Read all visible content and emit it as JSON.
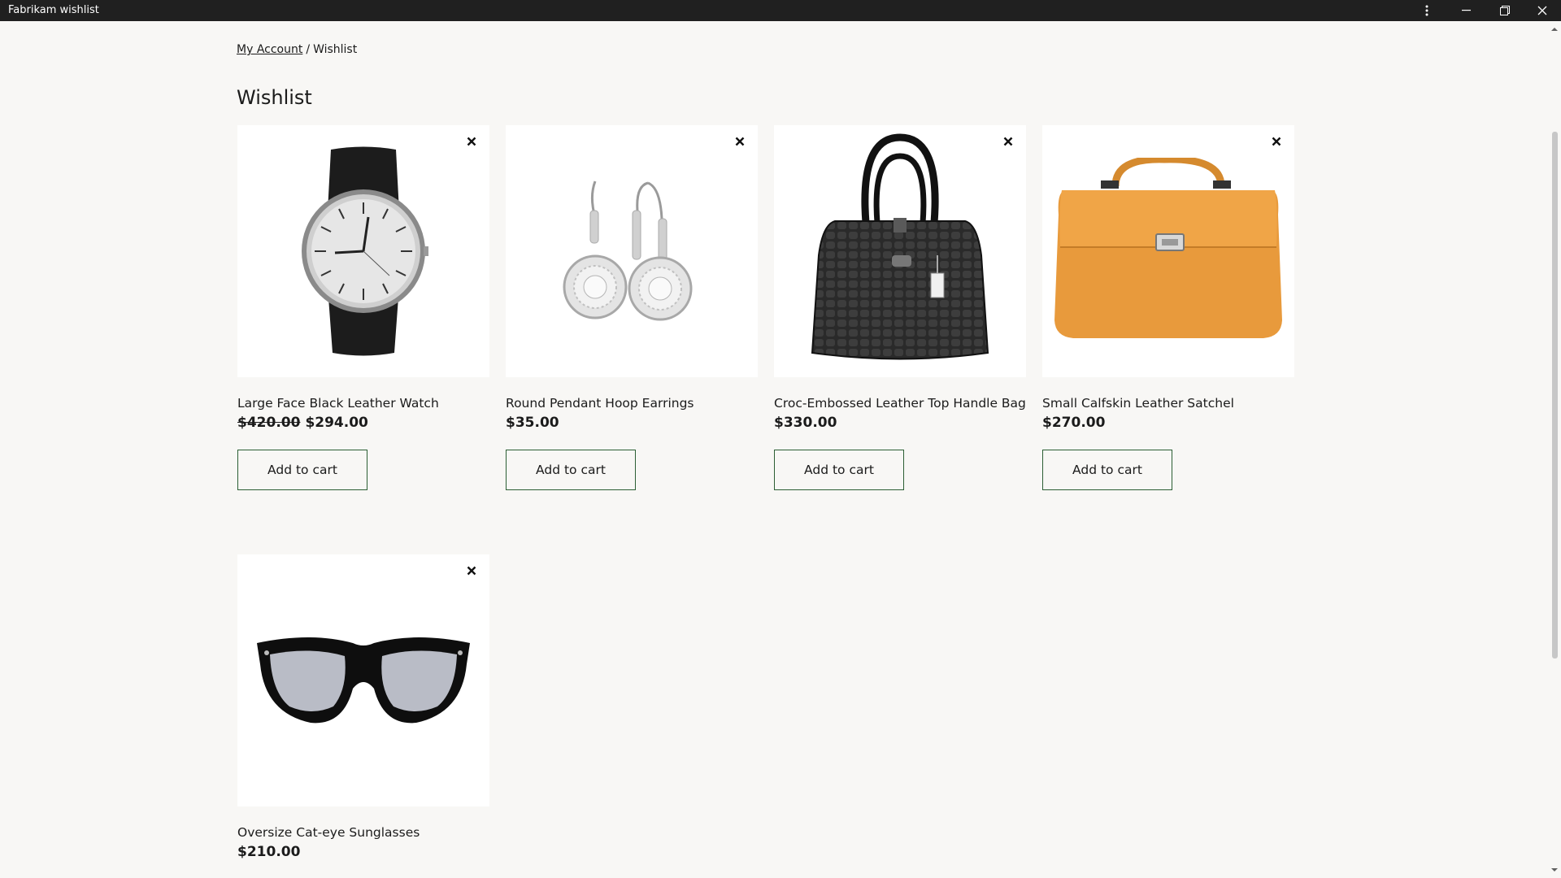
{
  "window": {
    "title": "Fabrikam wishlist"
  },
  "breadcrumb": {
    "parent": "My Account",
    "separator": "/",
    "current": "Wishlist"
  },
  "page": {
    "title": "Wishlist"
  },
  "products": [
    {
      "name": "Large Face Black Leather Watch",
      "old_price": "$420.00",
      "price": "$294.00",
      "button": "Add to cart",
      "image": "watch-image"
    },
    {
      "name": "Round Pendant Hoop Earrings",
      "price": "$35.00",
      "button": "Add to cart",
      "image": "earrings-image"
    },
    {
      "name": "Croc-Embossed Leather Top Handle Bag",
      "price": "$330.00",
      "button": "Add to cart",
      "image": "handbag-image"
    },
    {
      "name": "Small Calfskin Leather Satchel",
      "price": "$270.00",
      "button": "Add to cart",
      "image": "satchel-image"
    },
    {
      "name": "Oversize Cat-eye Sunglasses",
      "price": "$210.00",
      "image": "sunglasses-image"
    }
  ],
  "icons": {
    "remove": "close-icon",
    "more": "more-vertical-icon",
    "minimize": "minimize-icon",
    "maximize": "restore-icon",
    "close": "close-icon"
  },
  "colors": {
    "titlebar": "#202020",
    "background": "#f8f7f5",
    "button_border": "#2c5f34",
    "satchel": "#e89a3c"
  }
}
